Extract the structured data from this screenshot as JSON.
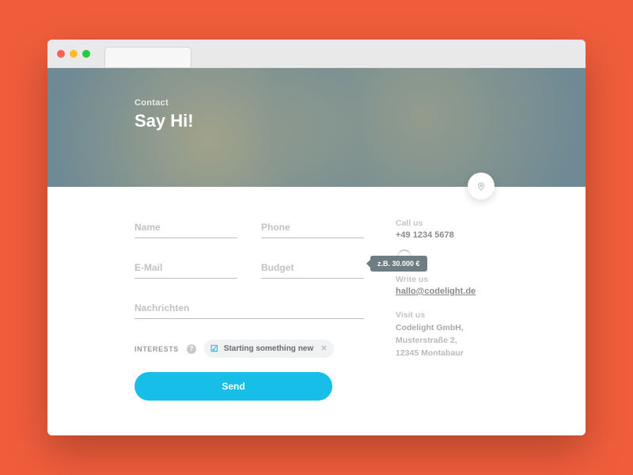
{
  "hero": {
    "eyebrow": "Contact",
    "title": "Say Hi!"
  },
  "form": {
    "name_ph": "Name",
    "phone_ph": "Phone",
    "email_ph": "E-Mail",
    "budget_ph": "Budget",
    "budget_hint": "z.B. 30.000 €",
    "message_ph": "Nachrichten",
    "interests_label": "INTERESTS",
    "chip_text": "Starting something new",
    "send_label": "Send"
  },
  "sidebar": {
    "call_label": "Call us",
    "call_value": "+49 1234 5678",
    "write_label": "Write us",
    "write_value": "hallo@codelight.de",
    "visit_label": "Visit us",
    "addr_company": "Codelight GmbH,",
    "addr_street": "Musterstraße 2,",
    "addr_city": "12345 Montabaur"
  }
}
